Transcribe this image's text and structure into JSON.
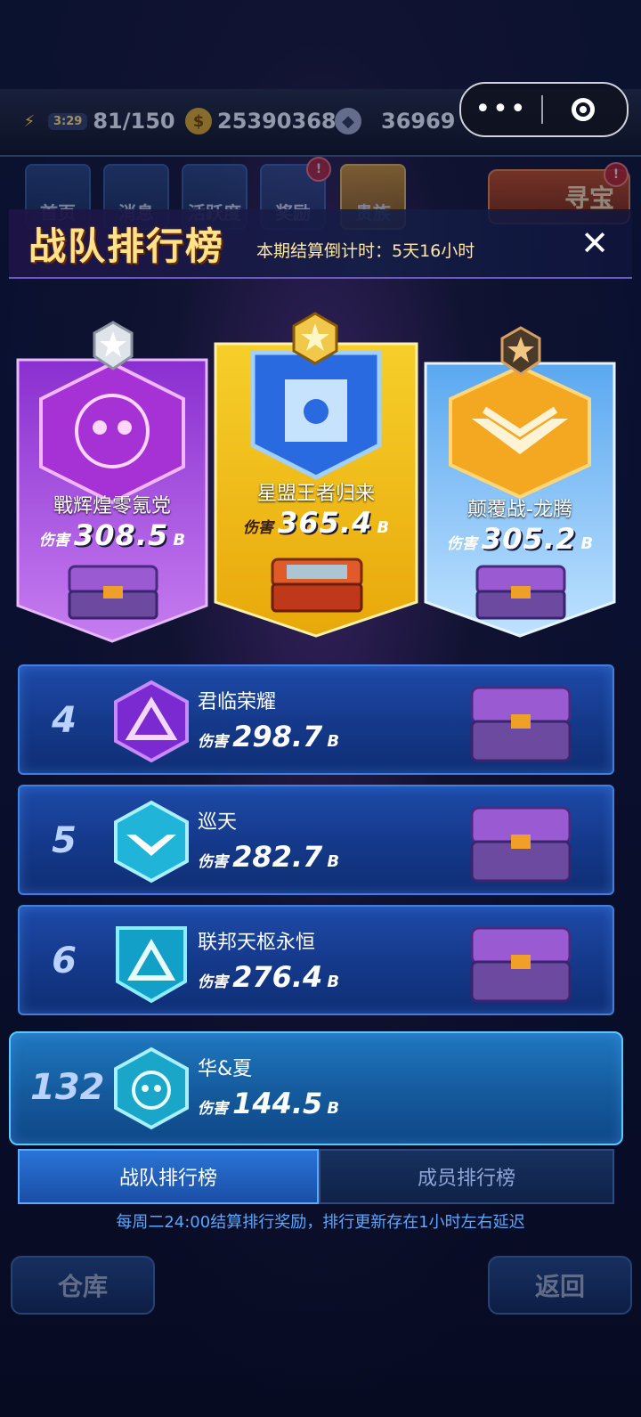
{
  "status_bar": {
    "timer": "3:29",
    "energy": "81/150",
    "gold": "25390368",
    "crystal": "36969"
  },
  "menu_tabs": [
    "首页",
    "消息",
    "活跃度",
    "奖励",
    "贵族"
  ],
  "menu_badges": [
    "!",
    "!"
  ],
  "treasure_label": "寻宝",
  "header": {
    "title": "战队排行榜",
    "countdown": "本期结算倒计时：5天16小时",
    "close": "✕"
  },
  "damage_label": "伤害",
  "damage_unit": "B",
  "podium": [
    {
      "rank": 2,
      "name": "戰辉煌零氪党",
      "damage": "308.5",
      "color": "#a43bd8"
    },
    {
      "rank": 1,
      "name": "星盟王者归来",
      "damage": "365.4",
      "color": "#f2c41e"
    },
    {
      "rank": 3,
      "name": "颠覆战-龙腾",
      "damage": "305.2",
      "color": "#3a8ee8"
    }
  ],
  "list": [
    {
      "rank": "4",
      "name": "君临荣耀",
      "damage": "298.7"
    },
    {
      "rank": "5",
      "name": "巡天",
      "damage": "282.7"
    },
    {
      "rank": "6",
      "name": "联邦天枢永恒",
      "damage": "276.4"
    }
  ],
  "mine": {
    "rank": "132",
    "name": "华&夏",
    "damage": "144.5"
  },
  "tabs": {
    "team": "战队排行榜",
    "member": "成员排行榜"
  },
  "notice": "每周二24:00结算排行奖励，排行更新存在1小时左右延迟",
  "bottom_buttons": {
    "warehouse": "仓库",
    "back": "返回"
  },
  "capsule": {
    "more": "•••"
  }
}
